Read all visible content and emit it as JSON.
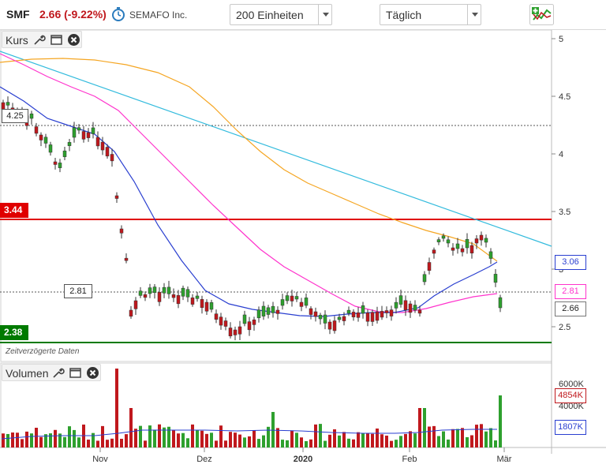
{
  "header": {
    "symbol": "SMF",
    "change": "2.66 (-9.22%)",
    "company": "SEMAFO Inc.",
    "units_select": "200 Einheiten",
    "interval_select": "Täglich"
  },
  "price_panel": {
    "title": "Kurs",
    "delayed_note": "Zeitverzögerte Daten",
    "level_labels": {
      "red": "3.44",
      "green": "2.38",
      "mid": "2.81",
      "top_left": "4.25"
    },
    "right_tags": {
      "blue": "3.06",
      "magenta": "2.81",
      "last": "2.66"
    },
    "y_ticks": [
      "5",
      "4.5",
      "4",
      "3.5",
      "3",
      "2.5"
    ]
  },
  "volume_panel": {
    "title": "Volumen",
    "y_ticks": [
      "6000K",
      "4000K"
    ],
    "right_tags": {
      "last": "4854K",
      "avg": "1807K"
    }
  },
  "x_ticks": [
    "Nov",
    "Dez",
    "2020",
    "Feb",
    "Mär"
  ],
  "colors": {
    "up": "#2ea02e",
    "down": "#c0181d",
    "sma20": "#2a3fd0",
    "sma50": "#ff33cc",
    "sma200": "#f5a623",
    "trend": "#33bbdd",
    "resistance": "#e00000",
    "support": "#007a00"
  },
  "chart_data": {
    "type": "candlestick",
    "y_range": [
      2.38,
      5.0
    ],
    "price_close_start": 4.5,
    "price_close_low": 2.38,
    "price_close_last": 2.66,
    "levels": [
      3.44,
      2.81,
      4.25,
      2.38
    ],
    "indicators": {
      "sma_fast_last": 3.06,
      "sma_mid_last": 2.81
    },
    "volume_last_k": 4854,
    "volume_avg_k": 1807
  }
}
